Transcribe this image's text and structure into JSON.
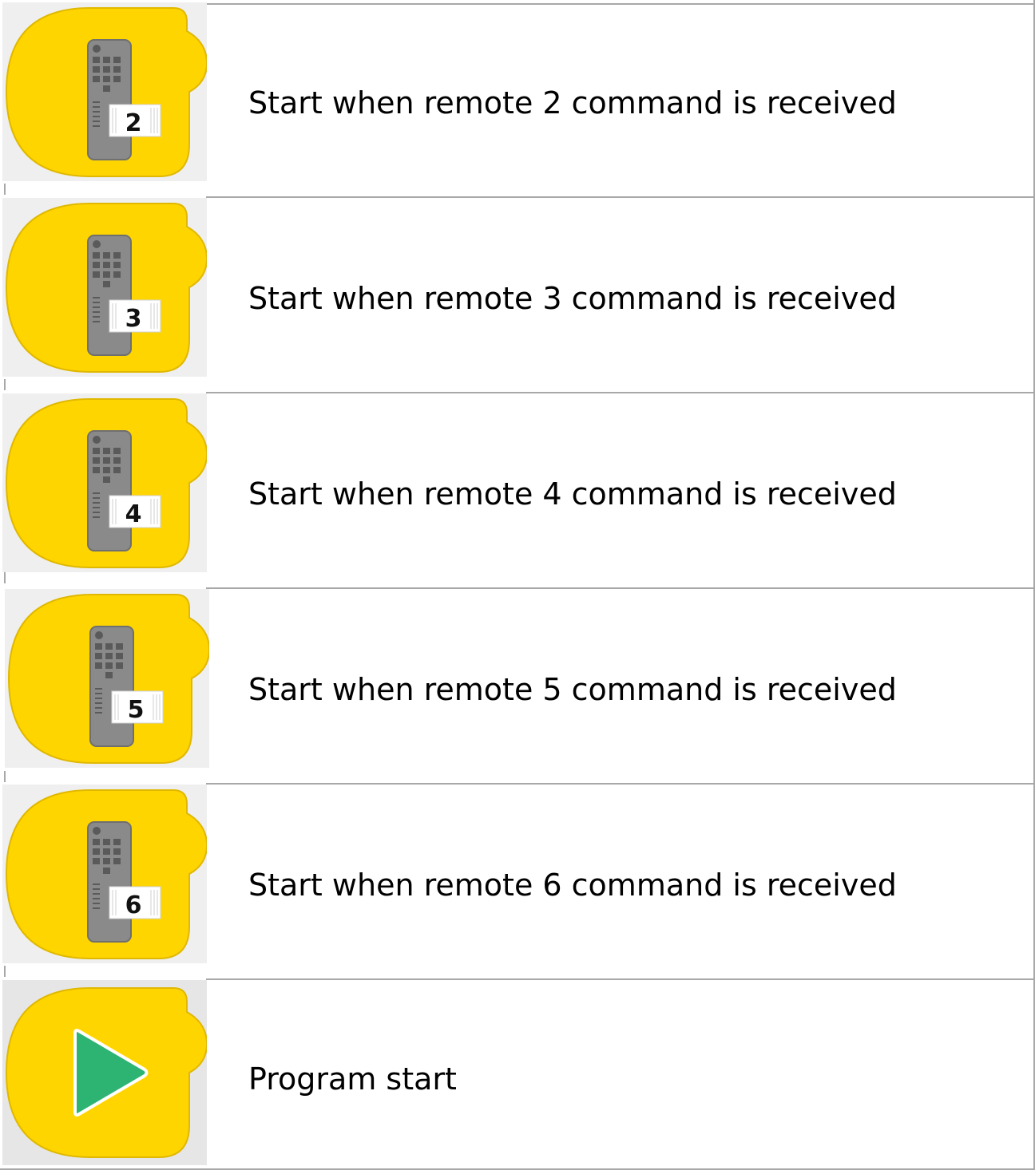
{
  "blocks": [
    {
      "badge": "2",
      "icon": "remote-control-icon",
      "description": "Start when remote 2 command is received"
    },
    {
      "badge": "3",
      "icon": "remote-control-icon",
      "description": "Start when remote 3 command is received"
    },
    {
      "badge": "4",
      "icon": "remote-control-icon",
      "description": "Start when remote 4 command is received"
    },
    {
      "badge": "5",
      "icon": "remote-control-icon",
      "description": "Start when remote 5 command is received"
    },
    {
      "badge": "6",
      "icon": "remote-control-icon",
      "description": "Start when remote 6 command is received"
    },
    {
      "badge": "",
      "icon": "play-icon",
      "description": "Program start"
    }
  ],
  "colors": {
    "block_yellow": "#FFD500",
    "block_outline": "#E0B800",
    "icon_bg": "#EFEFEF",
    "remote_gray": "#8A8A8A",
    "play_green": "#2DB472",
    "border_gray": "#A8A8A8"
  }
}
